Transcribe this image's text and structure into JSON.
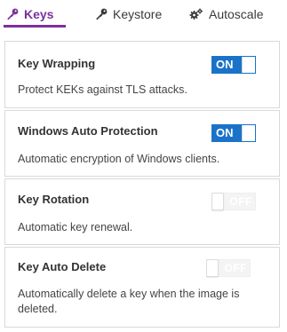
{
  "tabs": [
    {
      "label": "Keys",
      "icon": "key-icon",
      "active": true
    },
    {
      "label": "Keystore",
      "icon": "key-icon",
      "active": false
    },
    {
      "label": "Autoscale",
      "icon": "cogs-icon",
      "active": false
    }
  ],
  "settings": [
    {
      "title": "Key Wrapping",
      "description": "Protect KEKs against TLS attacks.",
      "state": "ON"
    },
    {
      "title": "Windows Auto Protection",
      "description": "Automatic encryption of Windows clients.",
      "state": "ON"
    },
    {
      "title": "Key Rotation",
      "description": "Automatic key renewal.",
      "state": "OFF"
    },
    {
      "title": "Key Auto Delete",
      "description": "Automatically delete a key when the image is deleted.",
      "state": "OFF"
    }
  ],
  "colors": {
    "accent": "#7b2f9e",
    "toggle_on": "#1a73c8",
    "toggle_off": "#f4f4f4"
  }
}
